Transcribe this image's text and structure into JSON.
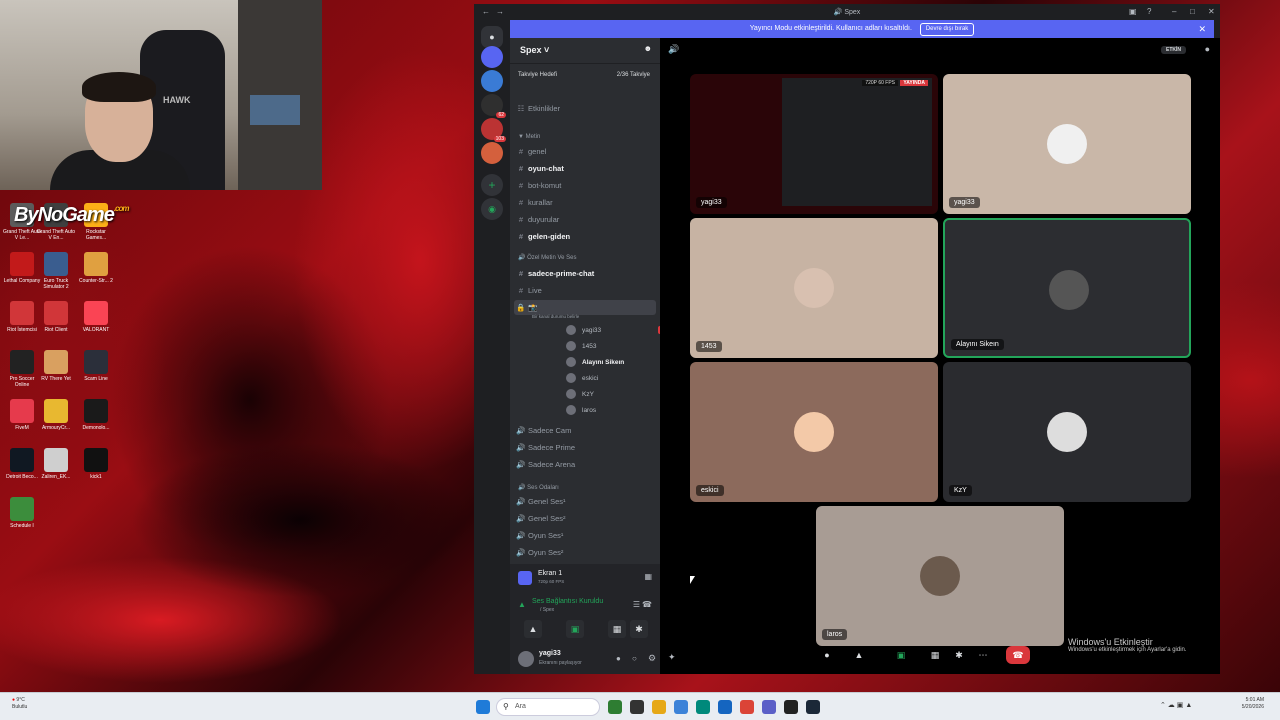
{
  "webcam": {
    "chair_brand": "HAWK"
  },
  "desktop": {
    "watermark": "ByNoGame",
    "watermark_suffix": ".com",
    "icons": [
      {
        "label": "Grand Theft Auto V Le...",
        "color": "#5b5b5b"
      },
      {
        "label": "Grand Theft Auto V En...",
        "color": "#3f3f3f"
      },
      {
        "label": "Rockstar Games...",
        "color": "#fcaf17"
      },
      {
        "label": "Lethal Company",
        "color": "#c21a1a"
      },
      {
        "label": "Euro Truck Simulator 2",
        "color": "#3a5d8f"
      },
      {
        "label": "Counter-Str... 2",
        "color": "#e0a040"
      },
      {
        "label": "Riot İstemcisi",
        "color": "#d13639"
      },
      {
        "label": "Riot Client",
        "color": "#d13639"
      },
      {
        "label": "VALORANT",
        "color": "#fa4454"
      },
      {
        "label": "Pro Soccer Online",
        "color": "#222"
      },
      {
        "label": "RV There Yet",
        "color": "#d9a060"
      },
      {
        "label": "Scam Line",
        "color": "#2b2f3a"
      },
      {
        "label": "FiveM",
        "color": "#e63a4c"
      },
      {
        "label": "ArmouryCr...",
        "color": "#e8b830"
      },
      {
        "label": "Demonolo...",
        "color": "#1a1a1a"
      },
      {
        "label": "Detroit Beco...",
        "color": "#101822"
      },
      {
        "label": "Zaliren_EK...",
        "color": "#cfcfcf"
      },
      {
        "label": "kick1",
        "color": "#111"
      },
      {
        "label": "Schedule I",
        "color": "#3c8d3c"
      }
    ]
  },
  "window": {
    "title": "Spex"
  },
  "banner": {
    "text": "Yayıncı Modu etkinleştirildi. Kullanıcı adları kısaltıldı.",
    "button": "Devre dışı bırak"
  },
  "guilds": [
    {
      "color": "#5865f2",
      "badge": ""
    },
    {
      "color": "#3a7bd5",
      "badge": ""
    },
    {
      "color": "#2f2f2f",
      "badge": "62"
    },
    {
      "color": "#b33",
      "badge": "103"
    },
    {
      "color": "#d4603d",
      "badge": ""
    }
  ],
  "server": {
    "name": "Spex",
    "boost_label": "Takviye Hedefi",
    "boost_value": "2/36 Takviye",
    "events": "Etkinlikler"
  },
  "categories": {
    "metin": "Metin",
    "ozel": "Özel Metin Ve Ses",
    "ses": "Ses Odaları"
  },
  "text_channels": [
    {
      "name": "genel",
      "icon": "#",
      "bold": false
    },
    {
      "name": "oyun-chat",
      "icon": "#",
      "bold": true
    },
    {
      "name": "bot-komut",
      "icon": "#",
      "bold": false
    },
    {
      "name": "kurallar",
      "icon": "#",
      "bold": false
    },
    {
      "name": "duyurular",
      "icon": "#",
      "bold": false
    },
    {
      "name": "gelen-giden",
      "icon": "#",
      "bold": true
    }
  ],
  "special_channels": [
    {
      "name": "sadece-prime-chat",
      "bold": true
    },
    {
      "name": "Live",
      "bold": false
    }
  ],
  "voice_channel": {
    "status": "Bir kanal durumu belirle"
  },
  "voice_users": [
    {
      "name": "yagi33",
      "live": "YAYINDA",
      "bold": false
    },
    {
      "name": "1453",
      "live": "",
      "bold": false
    },
    {
      "name": "Alayını Sikeın",
      "live": "",
      "bold": true
    },
    {
      "name": "eskici",
      "live": "",
      "bold": false
    },
    {
      "name": "KzY",
      "live": "",
      "bold": false
    },
    {
      "name": "laros",
      "live": "",
      "bold": false
    }
  ],
  "more_voice": [
    "Sadece Cam",
    "Sadece Prime",
    "Sadece Arena"
  ],
  "voice_rooms": [
    "Genel Ses¹",
    "Genel Ses²",
    "Oyun Ses¹",
    "Oyun Ses²"
  ],
  "panel": {
    "screen_title": "Ekran 1",
    "screen_sub": "720p 60 FPS",
    "conn_title": "Ses Bağlantısı Kuruldu",
    "conn_sub": "/ Spex",
    "user": "yagi33",
    "user_status": "Ekranını paylaşıyor"
  },
  "stage": {
    "badge": "ETKİN",
    "stream_quality": "720P 60 FPS",
    "stream_live": "YAYINDA"
  },
  "tiles": [
    {
      "name": "yagi33",
      "bg": "#2a0508"
    },
    {
      "name": "yagi33",
      "bg": "#c9b7a8"
    },
    {
      "name": "1453",
      "bg": "#c7b3a3"
    },
    {
      "name": "Alayını Sikeın",
      "bg": "#2c2d31"
    },
    {
      "name": "eskici",
      "bg": "#8c6a5c"
    },
    {
      "name": "KzY",
      "bg": "#2a2b2f"
    },
    {
      "name": "laros",
      "bg": "#a89c94"
    }
  ],
  "watermark": {
    "title": "Windows'u Etkinleştir",
    "sub": "Windows'u etkinleştirmek için Ayarlar'a gidin."
  },
  "taskbar": {
    "weather_temp": "9°C",
    "weather_desc": "Bulutlu",
    "search": "Ara",
    "time": "5:01 AM",
    "date": "5/20/2026"
  }
}
